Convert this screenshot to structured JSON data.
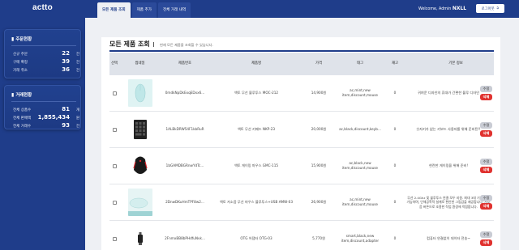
{
  "app": {
    "logo": "actto"
  },
  "tabs": [
    {
      "label": "모든 제품 조회",
      "active": true
    },
    {
      "label": "제품 추가",
      "active": false
    },
    {
      "label": "전체 거래 내역",
      "active": false
    }
  ],
  "header": {
    "welcome_prefix": "Welcome, Admin",
    "user": "NXLL",
    "logout_label": "로그아웃"
  },
  "cards": [
    {
      "title": "주문현황",
      "icon": "document-icon",
      "rows": [
        {
          "label": "신규 주문",
          "value": "22",
          "unit": "건"
        },
        {
          "label": "구매 확정",
          "value": "39",
          "unit": "건"
        },
        {
          "label": "거래 취소",
          "value": "36",
          "unit": "건"
        }
      ]
    },
    {
      "title": "거래현황",
      "icon": "receipt-icon",
      "rows": [
        {
          "label": "전체 상품수",
          "value": "81",
          "unit": "개"
        },
        {
          "label": "전체 판매액",
          "value": "1,855,434",
          "unit": "원"
        },
        {
          "label": "전체 거래수",
          "value": "93",
          "unit": "건"
        }
      ]
    }
  ],
  "page": {
    "title": "모든 제품 조회",
    "subtitle": "현재 모든 제품을 조회할 수 있습니다."
  },
  "table": {
    "columns": [
      "선택",
      "썸네일",
      "제품번호",
      "제품명",
      "가격",
      "태그",
      "재고",
      "기본 정보"
    ],
    "edit_label": "수정",
    "delete_label": "삭제",
    "rows": [
      {
        "id": "0mdkNpDkExqEDxx6...",
        "name": "액토 무선 블루투스 MOC-212",
        "price": "14,900원",
        "tags": "ac,mint,new\nitem,discount,mouse",
        "stock": "0",
        "info": "귀여운 디자인의 휴대가 간편한 블루 디자인"
      },
      {
        "id": "1ALBkDRW54F1kbRuR",
        "name": "액토 무선 키패드 NKP-23",
        "price": "20,000원",
        "tags": "ac,black,discount,keyb...",
        "stock": "0",
        "info": "숫자키가 없는 키보드 사용자를 위해 준비된!!"
      },
      {
        "id": "1bGAMDBGRnwYdTc...",
        "name": "액토 게이밍 마우스 GMC-115",
        "price": "15,900원",
        "tags": "ac,black,new\nitem,discount,mouse",
        "stock": "0",
        "info": "현란한 게이밍을 위해 준비!"
      },
      {
        "id": "2DnwDKuHmTPF8w2...",
        "name": "액토 저소음 무선 마우스 블루투스+USB AMW-03",
        "price": "26,900원",
        "tags": "ac,mint,new\nitem,discount,mouse",
        "stock": "0",
        "info": "무선 2.4Ghz 및 블루투스 연결 모두 지원. 최대 3대 기기 연결 가능하며, 인체공학적 설계로 편안한 그립감을 제공합니다. 저소음 버튼으로 조용한 작업 환경에 적합합니다."
      },
      {
        "id": "2FnmxBB8bPHdfuNvk...",
        "name": "OTG 어댑터 OTG-03",
        "price": "5,770원",
        "tags": "smart,black,new\nitem,discount,adapter",
        "stock": "0",
        "info": "컴퓨터 연결없이 데이터 전송~"
      }
    ]
  }
}
